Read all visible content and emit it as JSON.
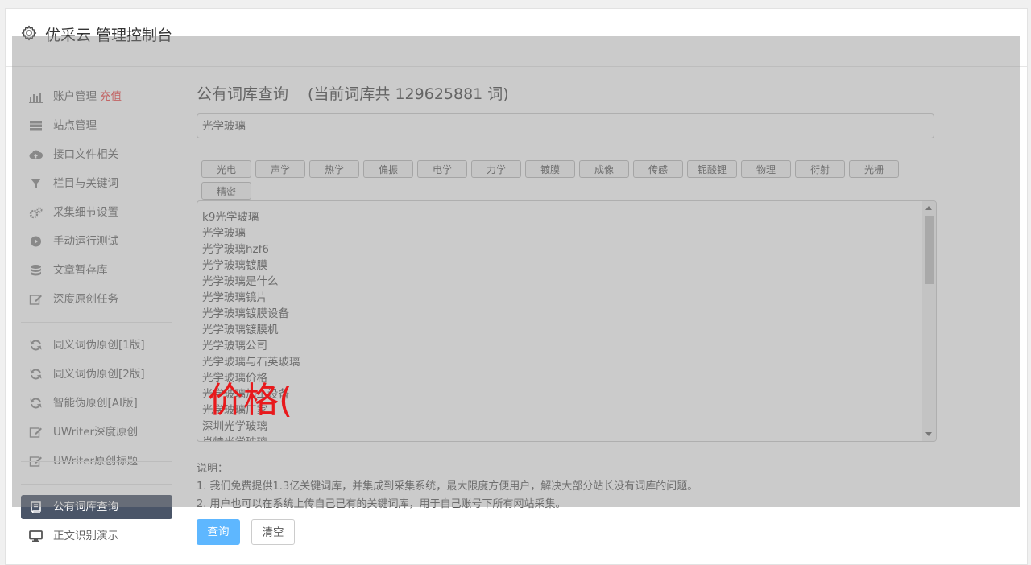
{
  "header": {
    "title": "优采云 管理控制台",
    "icon": "gear-icon"
  },
  "sidebar": {
    "items": [
      {
        "label": "账户管理",
        "extra": "充值",
        "icon": "bar-chart-icon"
      },
      {
        "label": "站点管理",
        "icon": "server-icon"
      },
      {
        "label": "接口文件相关",
        "icon": "cloud-upload-icon"
      },
      {
        "label": "栏目与关键词",
        "icon": "filter-icon"
      },
      {
        "label": "采集细节设置",
        "icon": "gears-icon"
      },
      {
        "label": "手动运行测试",
        "icon": "play-circle-icon"
      },
      {
        "label": "文章暂存库",
        "icon": "database-icon"
      },
      {
        "label": "深度原创任务",
        "icon": "edit-icon"
      },
      {
        "label": "同义词伪原创[1版]",
        "icon": "refresh-icon"
      },
      {
        "label": "同义词伪原创[2版]",
        "icon": "refresh-icon"
      },
      {
        "label": "智能伪原创[AI版]",
        "icon": "refresh-icon"
      },
      {
        "label": "UWriter深度原创",
        "icon": "edit-icon"
      },
      {
        "label": "UWriter原创标题",
        "icon": "edit-icon"
      },
      {
        "label": "公有词库查询",
        "icon": "book-icon",
        "active": true
      },
      {
        "label": "正文识别演示",
        "icon": "monitor-icon"
      }
    ]
  },
  "main": {
    "title": "公有词库查询",
    "count_text": "(当前词库共 129625881 词)",
    "search_value": "光学玻璃",
    "tags": [
      "光电",
      "声学",
      "热学",
      "偏振",
      "电学",
      "力学",
      "镀膜",
      "成像",
      "传感",
      "铌酸锂",
      "物理",
      "衍射",
      "光栅",
      "精密"
    ],
    "results": [
      "k9光学玻璃",
      "光学玻璃",
      "光学玻璃hzf6",
      "光学玻璃镀膜",
      "光学玻璃是什么",
      "光学玻璃镜片",
      "光学玻璃镀膜设备",
      "光学玻璃镀膜机",
      "光学玻璃公司",
      "光学玻璃与石英玻璃",
      "光学玻璃价格",
      "光学玻璃加工设备",
      "光学玻璃厂家",
      "深圳光学玻璃",
      "肖特光学玻璃"
    ],
    "notes": {
      "heading": "说明：",
      "lines": [
        "1. 我们免费提供1.3亿关键词库，并集成到采集系统，最大限度方便用户，解决大部分站长没有词库的问题。",
        "2. 用户也可以在系统上传自己已有的关键词库，用于自己账号下所有网站采集。"
      ]
    },
    "buttons": {
      "query": "查询",
      "clear": "清空"
    }
  },
  "overlay": {
    "ime_text": "价格("
  }
}
